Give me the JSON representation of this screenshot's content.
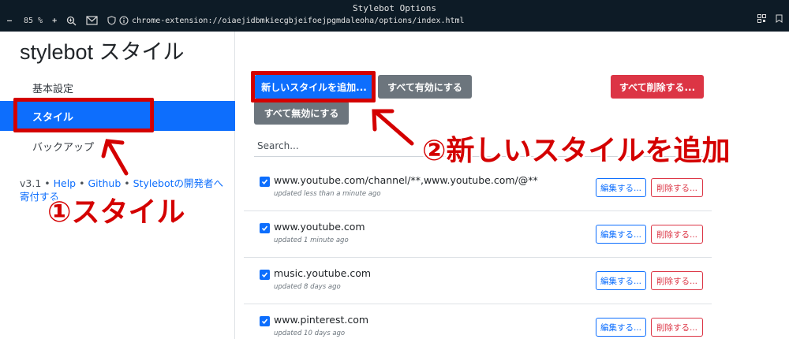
{
  "browser": {
    "window_title": "Stylebot Options",
    "zoom_out": "–",
    "zoom_level": "85 %",
    "zoom_in": "+",
    "url": "chrome-extension://oiaejidbmkiecgbjeifoejpgmdaleoha/options/index.html"
  },
  "sidebar": {
    "brand": "stylebot スタイル",
    "items": [
      {
        "label": "基本設定"
      },
      {
        "label": "スタイル",
        "active": true
      },
      {
        "label": "バックアップ"
      }
    ],
    "footer": {
      "version": "v3.1",
      "sep": " • ",
      "help": "Help",
      "github": "Github",
      "donate": "Stylebotの開発者へ寄付する"
    }
  },
  "actions": {
    "add": "新しいスタイルを追加...",
    "enable_all": "すべて有効にする",
    "delete_all": "すべて削除する...",
    "disable_all": "すべて無効にする"
  },
  "search": {
    "placeholder": "Search..."
  },
  "styles": [
    {
      "url": "www.youtube.com/channel/**,www.youtube.com/@**",
      "updated": "updated less than a minute ago",
      "checked": true,
      "edit": "編集する...",
      "delete": "削除する..."
    },
    {
      "url": "www.youtube.com",
      "updated": "updated 1 minute ago",
      "checked": true,
      "edit": "編集する...",
      "delete": "削除する..."
    },
    {
      "url": "music.youtube.com",
      "updated": "updated 8 days ago",
      "checked": true,
      "edit": "編集する...",
      "delete": "削除する..."
    },
    {
      "url": "www.pinterest.com",
      "updated": "updated 10 days ago",
      "checked": true,
      "edit": "編集する...",
      "delete": "削除する..."
    }
  ],
  "annotations": {
    "step1": "①スタイル",
    "step2": "②新しいスタイルを追加"
  },
  "colors": {
    "primary": "#0d6efd",
    "secondary": "#6c757d",
    "danger": "#dc3545",
    "annotation_red": "#d40000",
    "chrome_bg": "#0d1b26"
  }
}
